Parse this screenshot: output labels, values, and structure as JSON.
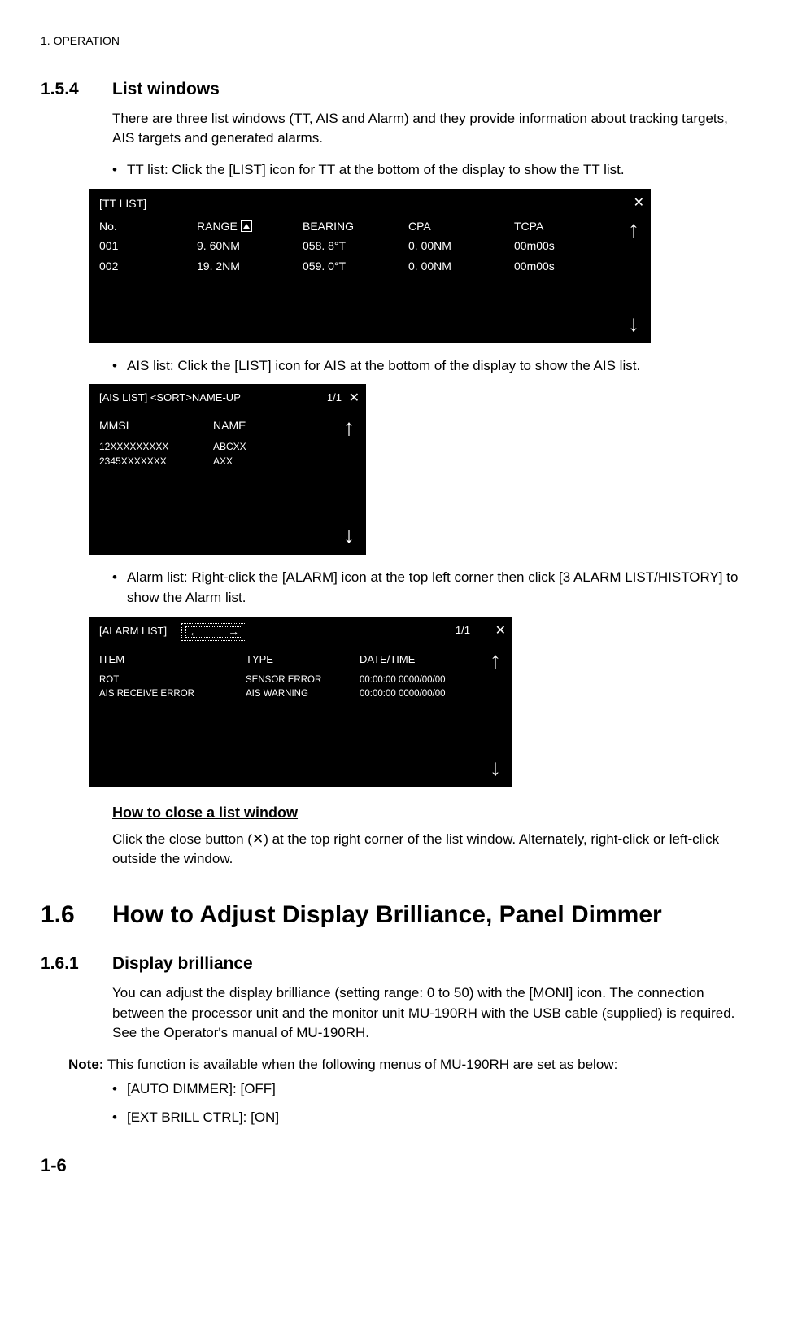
{
  "chapter_header": "1.  OPERATION",
  "page_number": "1-6",
  "s154": {
    "num": "1.5.4",
    "title": "List windows",
    "intro": "There are three list windows (TT, AIS and Alarm) and they provide information about tracking targets, AIS targets and generated alarms.",
    "tt_bullet": "TT list: Click the [LIST] icon for TT at the bottom of the display to show the TT list.",
    "ais_bullet": "AIS list: Click the [LIST] icon for AIS at the bottom of the display to show the AIS list.",
    "alarm_bullet": "Alarm list: Right-click the [ALARM] icon at the top left corner then click [3 ALARM LIST/HISTORY] to show the Alarm list.",
    "close_title": "How to close a list window",
    "close_para": "Click the close button (✕) at the top right corner of the list window. Alternately, right-click or left-click outside the window."
  },
  "tt_panel": {
    "title": "[TT LIST]",
    "headers": {
      "no": "No.",
      "range": "RANGE",
      "bearing": "BEARING",
      "cpa": "CPA",
      "tcpa": "TCPA"
    },
    "rows": [
      {
        "no": "001",
        "range": "9. 60NM",
        "bearing": "058. 8°T",
        "cpa": "0. 00NM",
        "tcpa": "00m00s"
      },
      {
        "no": "002",
        "range": "19. 2NM",
        "bearing": "059. 0°T",
        "cpa": "0. 00NM",
        "tcpa": "00m00s"
      }
    ]
  },
  "ais_panel": {
    "title": "[AIS LIST] <SORT>NAME-UP",
    "page": "1/1",
    "headers": {
      "mmsi": "MMSI",
      "name": "NAME"
    },
    "rows": [
      {
        "mmsi": "12XXXXXXXXX",
        "name": "ABCXX"
      },
      {
        "mmsi": "2345XXXXXXX",
        "name": "AXX"
      }
    ]
  },
  "alarm_panel": {
    "title": "[ALARM LIST]",
    "page": "1/1",
    "headers": {
      "item": "ITEM",
      "type": "TYPE",
      "date": "DATE/TIME"
    },
    "rows": [
      {
        "item": "ROT",
        "type": "SENSOR ERROR",
        "date": "00:00:00  0000/00/00"
      },
      {
        "item": "AIS RECEIVE ERROR",
        "type": "AIS WARNING",
        "date": "00:00:00  0000/00/00"
      }
    ]
  },
  "s16": {
    "num": "1.6",
    "title": "How to Adjust Display Brilliance, Panel Dimmer"
  },
  "s161": {
    "num": "1.6.1",
    "title": "Display brilliance",
    "para": "You can adjust the display brilliance (setting range: 0 to 50) with the [MONI] icon. The connection between the processor unit and the monitor unit MU-190RH with the USB cable (supplied) is required. See the Operator's manual of MU-190RH.",
    "note_label": "Note:",
    "note_text": " This function is available when the following menus of MU-190RH are set as below:",
    "b1": "[AUTO DIMMER]: [OFF]",
    "b2": "[EXT BRILL CTRL]: [ON]"
  }
}
